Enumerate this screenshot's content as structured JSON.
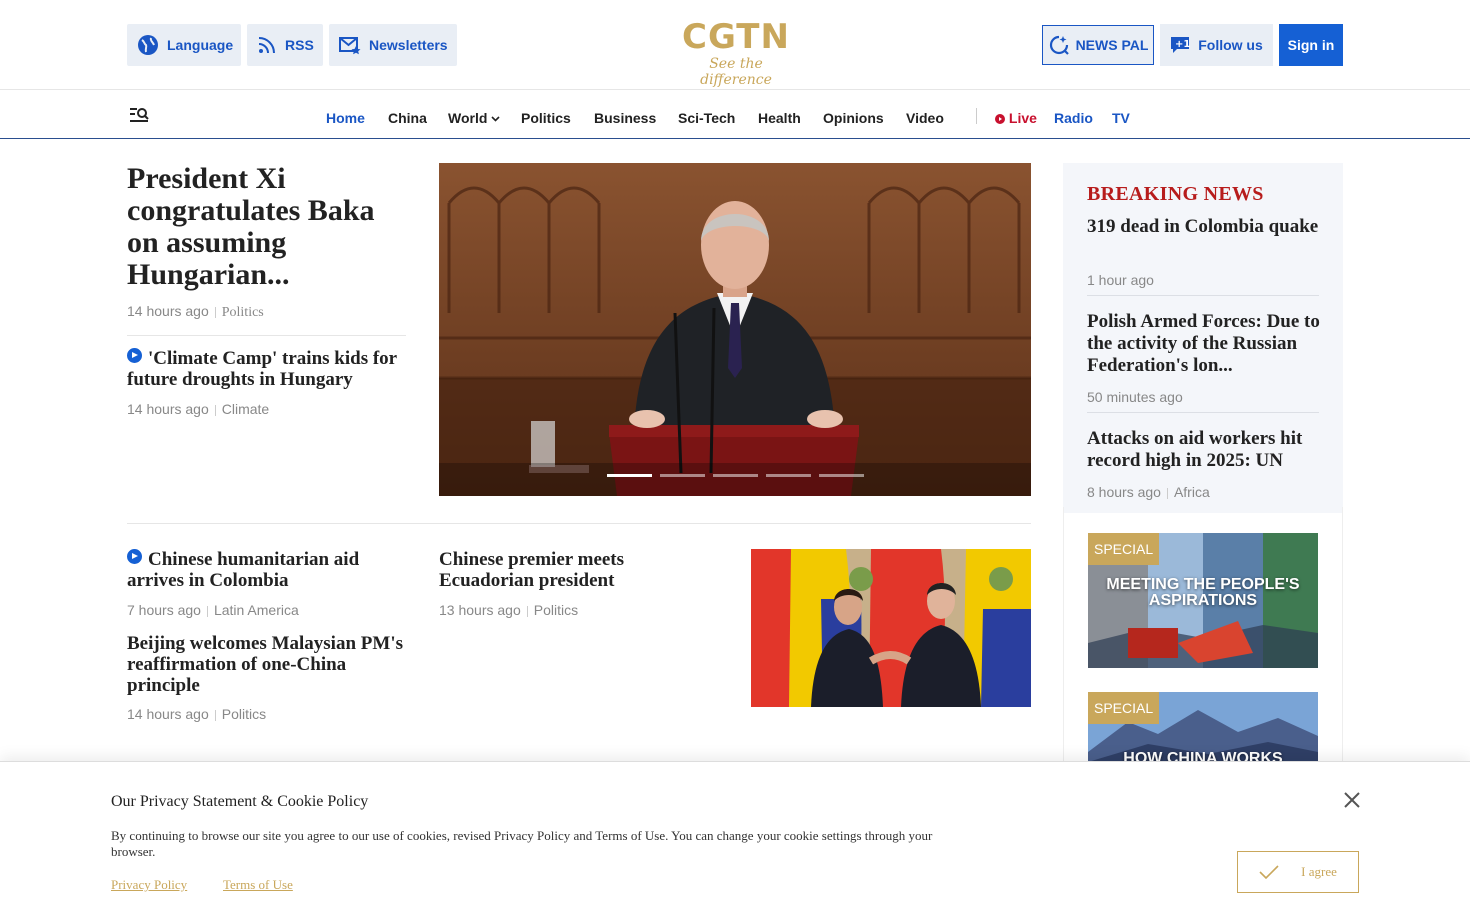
{
  "topbar": {
    "language_label": "Language",
    "rss_label": "RSS",
    "newsletters_label": "Newsletters",
    "logo_text": "CGTN",
    "logo_tagline": "See the difference",
    "newspal_label": "NEWS PAL",
    "follow_label": "Follow us",
    "signin_label": "Sign in"
  },
  "nav": {
    "items": [
      "Home",
      "China",
      "World",
      "Politics",
      "Business",
      "Sci-Tech",
      "Health",
      "Opinions",
      "Video"
    ],
    "active": "Home",
    "live_label": "Live",
    "radio_label": "Radio",
    "tv_label": "TV"
  },
  "hero": {
    "title": "President Xi congratulates Baka on assuming Hungarian...",
    "time": "14 hours ago",
    "category": "Politics",
    "slides": 5,
    "active_slide": 1
  },
  "stories": [
    {
      "title": "'Climate Camp' trains kids for future droughts in Hungary",
      "time": "14 hours ago",
      "category": "Climate",
      "video": true
    },
    {
      "title": "Chinese humanitarian aid arrives in Colombia",
      "time": "7 hours ago",
      "category": "Latin America",
      "video": true
    },
    {
      "title": "Beijing welcomes Malaysian PM's reaffirmation of one-China principle",
      "time": "14 hours ago",
      "category": "Politics",
      "video": false
    },
    {
      "title": "Chinese premier meets Ecuadorian president",
      "time": "13 hours ago",
      "category": "Politics",
      "video": false
    }
  ],
  "breaking": {
    "heading": "BREAKING NEWS",
    "items": [
      {
        "title": "319 dead in Colombia quake",
        "time": "1 hour ago",
        "category": ""
      },
      {
        "title": "Polish Armed Forces: Due to the activity of the Russian Federation's lon...",
        "time": "50 minutes ago",
        "category": ""
      },
      {
        "title": "Attacks on aid workers hit record high in 2025: UN",
        "time": "8 hours ago",
        "category": "Africa"
      }
    ]
  },
  "specials": [
    {
      "tag": "SPECIAL",
      "title": "MEETING THE PEOPLE'S ASPIRATIONS"
    },
    {
      "tag": "SPECIAL",
      "title": "HOW CHINA WORKS"
    }
  ],
  "cookie": {
    "title": "Our Privacy Statement & Cookie Policy",
    "text": "By continuing to browse our site you agree to our use of cookies, revised Privacy Policy and Terms of Use. You can change your cookie settings through your browser.",
    "privacy_link": "Privacy Policy",
    "terms_link": "Terms of Use",
    "agree_label": "I agree"
  },
  "colors": {
    "brand_gold": "#c9a75b",
    "link_blue": "#1a56c4",
    "breaking_red": "#b71c1c",
    "signin_blue": "#1560d4"
  }
}
